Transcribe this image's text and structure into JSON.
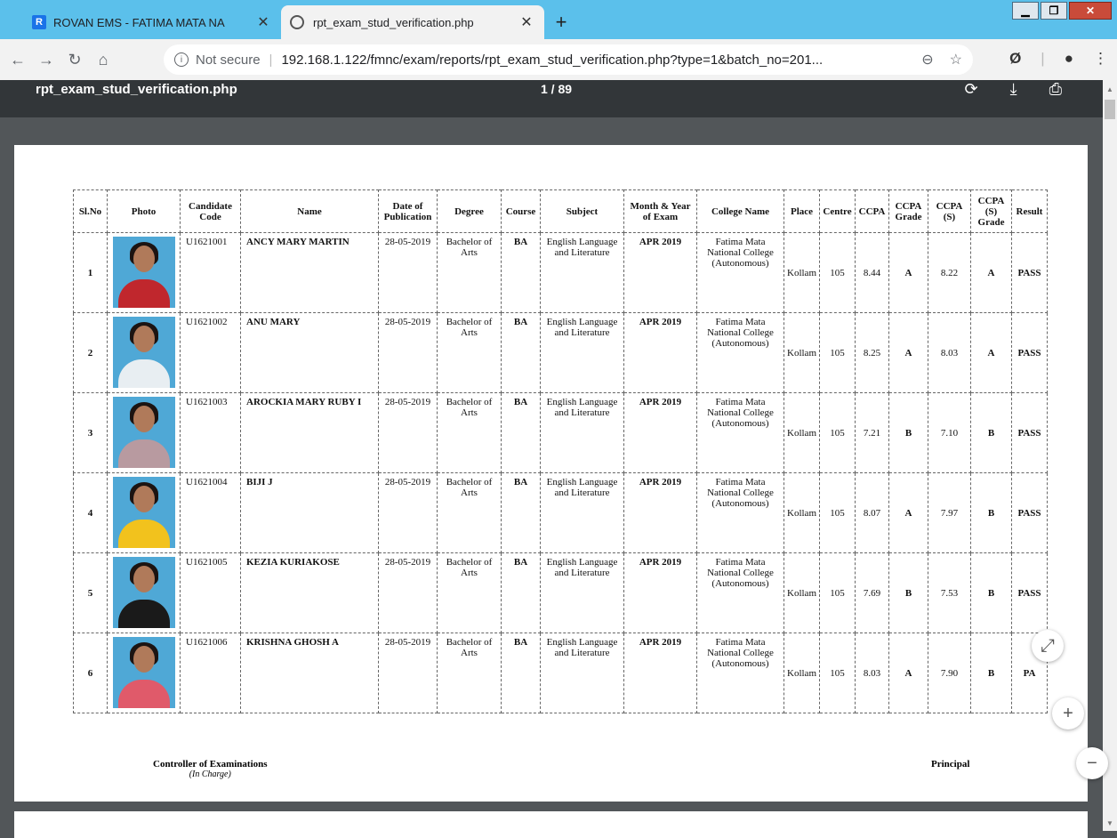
{
  "browser": {
    "tabs": [
      {
        "title": "ROVAN EMS - FATIMA MATA NA",
        "active": false
      },
      {
        "title": "rpt_exam_stud_verification.php",
        "active": true
      }
    ],
    "new_tab": "+",
    "url_prefix": "Not secure",
    "url": "192.168.1.122/fmnc/exam/reports/rpt_exam_stud_verification.php?type=1&batch_no=201..."
  },
  "pdf": {
    "title": "rpt_exam_stud_verification.php",
    "page_indicator": "1 / 89"
  },
  "table": {
    "headers": [
      "Sl.No",
      "Photo",
      "Candidate Code",
      "Name",
      "Date of Publication",
      "Degree",
      "Course",
      "Subject",
      "Month & Year of Exam",
      "College Name",
      "Place",
      "Centre",
      "CCPA",
      "CCPA Grade",
      "CCPA (S)",
      "CCPA (S) Grade",
      "Result"
    ],
    "rows": [
      {
        "sl": "1",
        "code": "U1621001",
        "name": "ANCY MARY MARTIN",
        "date": "28-05-2019",
        "degree": "Bachelor of Arts",
        "course": "BA",
        "subject": "English Language and Literature",
        "exam": "APR 2019",
        "college": "Fatima Mata National College (Autonomous)",
        "place": "Kollam",
        "centre": "105",
        "ccpa": "8.44",
        "grade": "A",
        "ccpa_s": "8.22",
        "grade_s": "A",
        "result": "PASS",
        "bg": "#c0272d"
      },
      {
        "sl": "2",
        "code": "U1621002",
        "name": "ANU MARY",
        "date": "28-05-2019",
        "degree": "Bachelor of Arts",
        "course": "BA",
        "subject": "English Language and Literature",
        "exam": "APR 2019",
        "college": "Fatima Mata National College (Autonomous)",
        "place": "Kollam",
        "centre": "105",
        "ccpa": "8.25",
        "grade": "A",
        "ccpa_s": "8.03",
        "grade_s": "A",
        "result": "PASS",
        "bg": "#e8eef2"
      },
      {
        "sl": "3",
        "code": "U1621003",
        "name": "AROCKIA MARY RUBY  I",
        "date": "28-05-2019",
        "degree": "Bachelor of Arts",
        "course": "BA",
        "subject": "English Language and Literature",
        "exam": "APR 2019",
        "college": "Fatima Mata National College (Autonomous)",
        "place": "Kollam",
        "centre": "105",
        "ccpa": "7.21",
        "grade": "B",
        "ccpa_s": "7.10",
        "grade_s": "B",
        "result": "PASS",
        "bg": "#b89aa0"
      },
      {
        "sl": "4",
        "code": "U1621004",
        "name": "BIJI J",
        "date": "28-05-2019",
        "degree": "Bachelor of Arts",
        "course": "BA",
        "subject": "English Language and Literature",
        "exam": "APR 2019",
        "college": "Fatima Mata National College (Autonomous)",
        "place": "Kollam",
        "centre": "105",
        "ccpa": "8.07",
        "grade": "A",
        "ccpa_s": "7.97",
        "grade_s": "B",
        "result": "PASS",
        "bg": "#f2c21d"
      },
      {
        "sl": "5",
        "code": "U1621005",
        "name": "KEZIA KURIAKOSE",
        "date": "28-05-2019",
        "degree": "Bachelor of Arts",
        "course": "BA",
        "subject": "English Language and Literature",
        "exam": "APR 2019",
        "college": "Fatima Mata National College (Autonomous)",
        "place": "Kollam",
        "centre": "105",
        "ccpa": "7.69",
        "grade": "B",
        "ccpa_s": "7.53",
        "grade_s": "B",
        "result": "PASS",
        "bg": "#1a1a1a"
      },
      {
        "sl": "6",
        "code": "U1621006",
        "name": "KRISHNA GHOSH A",
        "date": "28-05-2019",
        "degree": "Bachelor of Arts",
        "course": "BA",
        "subject": "English Language and Literature",
        "exam": "APR 2019",
        "college": "Fatima Mata National College (Autonomous)",
        "place": "Kollam",
        "centre": "105",
        "ccpa": "8.03",
        "grade": "A",
        "ccpa_s": "7.90",
        "grade_s": "B",
        "result": "PA",
        "bg": "#e05a6a"
      }
    ]
  },
  "signatures": {
    "left_title": "Controller of Examinations",
    "left_sub": "(In Charge)",
    "right_title": "Principal"
  }
}
